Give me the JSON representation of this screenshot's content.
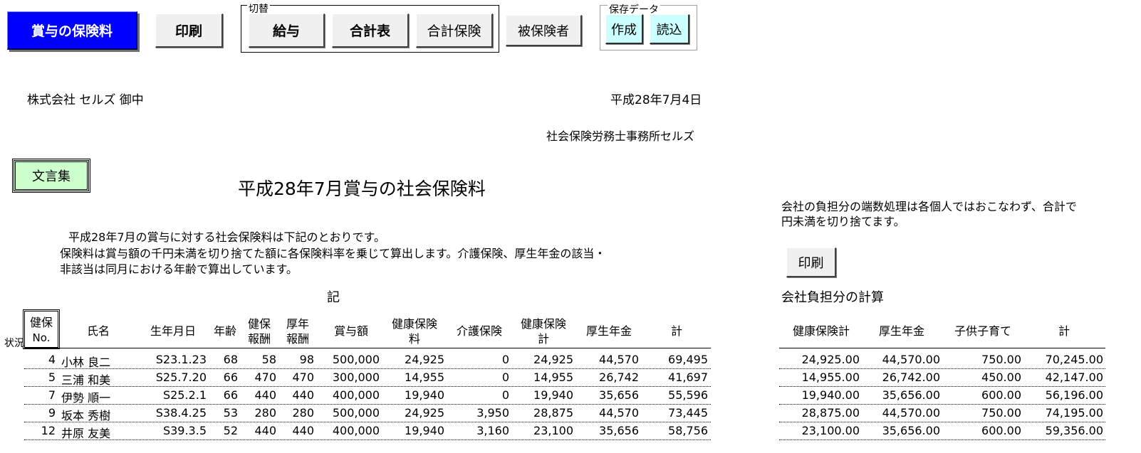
{
  "toolbar": {
    "bonus_insurance": "賞与の保険料",
    "print": "印刷",
    "switch_group_label": "切替",
    "salary": "給与",
    "total_table": "合計表",
    "total_insurance": "合計保険",
    "insured": "被保険者",
    "saved_data_label": "保存データ",
    "create": "作成",
    "load": "読込"
  },
  "document": {
    "recipient": "株式会社  セルズ 御中",
    "date": "平成28年7月4日",
    "office": "社会保険労務士事務所セルズ",
    "phrases_button": "文言集",
    "title": "平成28年7月賞与の社会保険料",
    "intro_line1": "平成28年7月の賞与に対する社会保険料は下記のとおりです。",
    "intro_line2": "保険料は賞与額の千円未満を切り捨てた額に各保険料率を乗じて算出します。介護保険、厚生年金の該当・",
    "intro_line3": "非該当は同月における年齢で算出しています。",
    "ki": "記",
    "side_note_line1": "会社の負担分の端数処理は各個人ではおこなわず、合計で",
    "side_note_line2": "円未満を切り捨てます。",
    "side_print": "印刷",
    "company_calc_title": "会社負担分の計算"
  },
  "table": {
    "status_label": "状況",
    "headers": {
      "no_line1": "健保",
      "no_line2": "No.",
      "name": "氏名",
      "birth": "生年月日",
      "age": "年齢",
      "kenpo_hoshu_1": "健保",
      "kenpo_hoshu_2": "報酬",
      "kosei_hoshu_1": "厚年",
      "kosei_hoshu_2": "報酬",
      "bonus": "賞与額",
      "health_1": "健康保険",
      "health_2": "料",
      "care": "介護保険",
      "health_total_1": "健康保険",
      "health_total_2": "計",
      "pension": "厚生年金",
      "total": "計"
    },
    "rows": [
      {
        "no": "4",
        "name": "小林 良二",
        "birth": "S23.1.23",
        "age": "68",
        "kh": "58",
        "ko": "98",
        "bonus": "500,000",
        "health": "24,925",
        "care": "0",
        "htotal": "24,925",
        "pension": "44,570",
        "total": "69,495"
      },
      {
        "no": "5",
        "name": "三浦 和美",
        "birth": "S25.7.20",
        "age": "66",
        "kh": "470",
        "ko": "470",
        "bonus": "300,000",
        "health": "14,955",
        "care": "0",
        "htotal": "14,955",
        "pension": "26,742",
        "total": "41,697"
      },
      {
        "no": "7",
        "name": "伊勢 順一",
        "birth": "S25.2.1",
        "age": "66",
        "kh": "440",
        "ko": "440",
        "bonus": "400,000",
        "health": "19,940",
        "care": "0",
        "htotal": "19,940",
        "pension": "35,656",
        "total": "55,596"
      },
      {
        "no": "9",
        "name": "坂本 秀樹",
        "birth": "S38.4.25",
        "age": "53",
        "kh": "280",
        "ko": "280",
        "bonus": "500,000",
        "health": "24,925",
        "care": "3,950",
        "htotal": "28,875",
        "pension": "44,570",
        "total": "73,445"
      },
      {
        "no": "12",
        "name": "井原 友美",
        "birth": "S39.3.5",
        "age": "52",
        "kh": "440",
        "ko": "440",
        "bonus": "400,000",
        "health": "19,940",
        "care": "3,160",
        "htotal": "23,100",
        "pension": "35,656",
        "total": "58,756"
      }
    ]
  },
  "company_table": {
    "headers": {
      "health_total": "健康保険計",
      "pension": "厚生年金",
      "child": "子供子育て",
      "total": "計"
    },
    "rows": [
      {
        "health": "24,925.00",
        "pension": "44,570.00",
        "child": "750.00",
        "total": "70,245.00"
      },
      {
        "health": "14,955.00",
        "pension": "26,742.00",
        "child": "450.00",
        "total": "42,147.00"
      },
      {
        "health": "19,940.00",
        "pension": "35,656.00",
        "child": "600.00",
        "total": "56,196.00"
      },
      {
        "health": "28,875.00",
        "pension": "44,570.00",
        "child": "750.00",
        "total": "74,195.00"
      },
      {
        "health": "23,100.00",
        "pension": "35,656.00",
        "child": "600.00",
        "total": "59,356.00"
      }
    ]
  }
}
